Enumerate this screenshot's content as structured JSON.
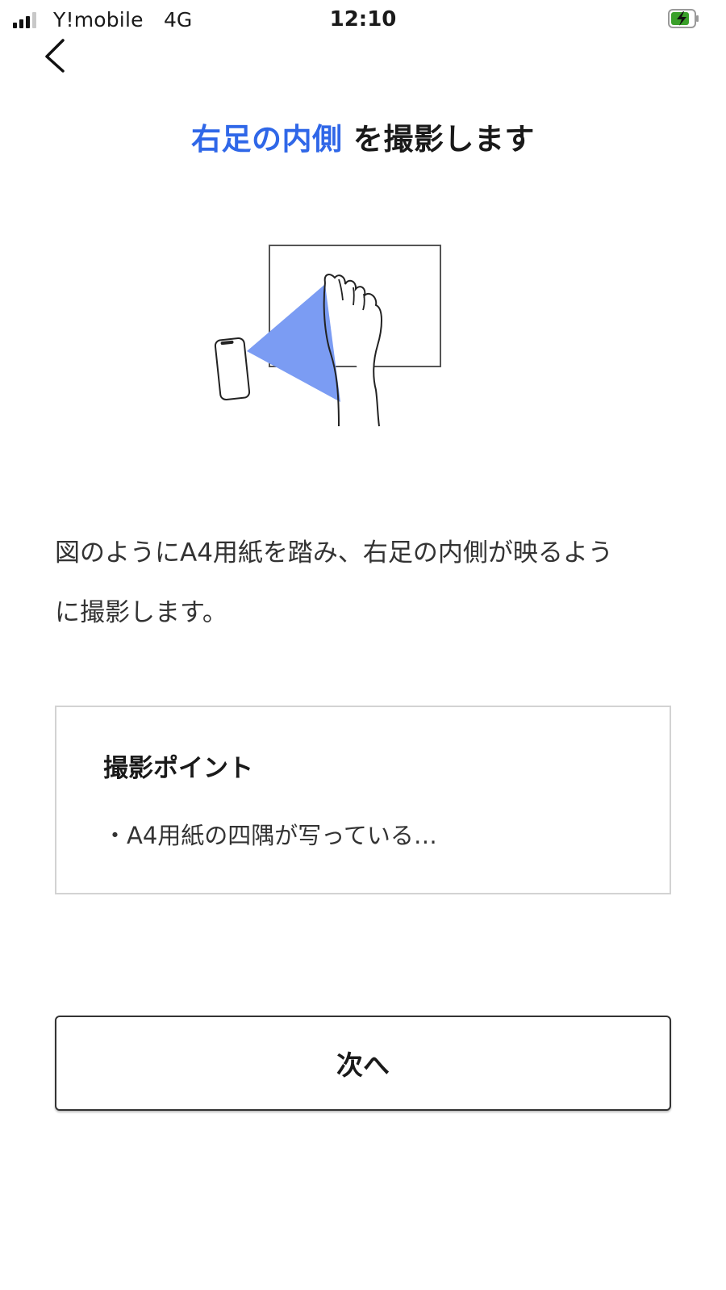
{
  "status_bar": {
    "carrier": "Y!mobile",
    "network": "4G",
    "time": "12:10",
    "battery_color": "#3aa02a"
  },
  "nav": {
    "back_icon": "chevron-left-icon"
  },
  "title": {
    "highlight": "右足の内側",
    "rest": " を撮影します",
    "accent_color": "#2f67e8"
  },
  "illustration": {
    "icon": "foot-on-paper-camera-illustration",
    "cone_color": "#7b9cf3"
  },
  "description": {
    "line1": "図のようにA4用紙を踏み、右足の内側が映るよう",
    "line2": "に撮影します。"
  },
  "tips": {
    "title": "撮影ポイント",
    "item": "・A4用紙の四隅が写っている…"
  },
  "next_button": {
    "label": "次へ"
  }
}
